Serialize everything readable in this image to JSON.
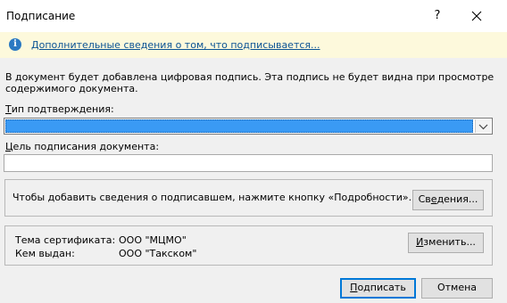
{
  "window": {
    "title": "Подписание",
    "help_glyph": "?",
    "close_glyph": "✕"
  },
  "infobar": {
    "icon": "info-icon",
    "icon_glyph": "i",
    "link_text": "Дополнительные сведения о том, что подписывается..."
  },
  "description": "В документ будет добавлена цифровая подпись. Эта подпись не будет видна при просмотре содержимого документа.",
  "commitment": {
    "label_first": "Т",
    "label_rest": "ип подтверждения:",
    "value": ""
  },
  "purpose": {
    "label_first": "Ц",
    "label_rest": "ель подписания документа:",
    "value": ""
  },
  "signer_info": {
    "text": "Чтобы добавить сведения о подписавшем, нажмите кнопку «Подробности».",
    "button_first": "Св",
    "button_underline": "е",
    "button_rest": "дения..."
  },
  "certificate": {
    "subject_label": "Тема сертификата:",
    "subject_value": "ООО \"МЦМО\"",
    "issuer_label": "Кем выдан:",
    "issuer_value": "ООО \"Такском\"",
    "change_button_underline": "И",
    "change_button_rest": "зменить..."
  },
  "buttons": {
    "sign_underline": "П",
    "sign_rest": "одписать",
    "cancel": "Отмена"
  },
  "colors": {
    "accent": "#0078d7",
    "selection": "#3a9af4",
    "infobar_bg": "#fdf9dc",
    "link": "#0b5394"
  }
}
